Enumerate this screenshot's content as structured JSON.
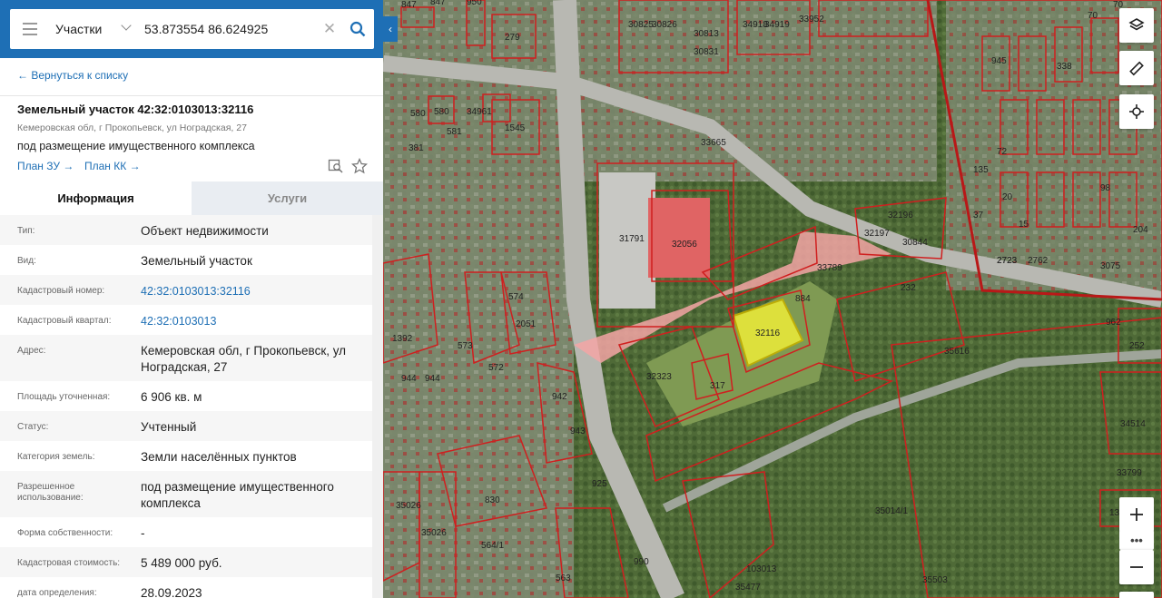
{
  "search": {
    "type_label": "Участки",
    "coords_value": "53.873554 86.624925"
  },
  "nav": {
    "back_label": "← Вернуться к списку"
  },
  "object": {
    "title": "Земельный участок 42:32:0103013:32116",
    "address_short": "Кемеровская обл, г Прокопьевск, ул Ноградская, 27",
    "purpose": "под размещение имущественного комплекса",
    "plan_zu": "План ЗУ →",
    "plan_kk": "План КК →"
  },
  "tabs": {
    "info": "Информация",
    "services": "Услуги"
  },
  "info_rows": [
    {
      "label": "Тип:",
      "value": "Объект недвижимости"
    },
    {
      "label": "Вид:",
      "value": "Земельный участок"
    },
    {
      "label": "Кадастровый номер:",
      "value": "42:32:0103013:32116"
    },
    {
      "label": "Кадастровый квартал:",
      "value": "42:32:0103013"
    },
    {
      "label": "Адрес:",
      "value": "Кемеровская обл, г Прокопьевск, ул Ноградская, 27"
    },
    {
      "label": "Площадь уточненная:",
      "value": "6 906 кв. м"
    },
    {
      "label": "Статус:",
      "value": "Учтенный"
    },
    {
      "label": "Категория земель:",
      "value": "Земли населённых пунктов"
    },
    {
      "label": "Разрешенное использование:",
      "value": "под размещение имущественного комплекса"
    },
    {
      "label": "Форма собственности:",
      "value": "-"
    },
    {
      "label": "Кадастровая стоимость:",
      "value": "5 489 000 руб."
    },
    {
      "label": "дата определения:",
      "value": "28.09.2023"
    }
  ],
  "map": {
    "parcel_labels": [
      "847",
      "847",
      "950",
      "279",
      "580",
      "580",
      "581",
      "381",
      "34961",
      "1545",
      "33665",
      "31791",
      "32056",
      "33789",
      "32116",
      "884",
      "32323",
      "317",
      "35616",
      "962",
      "252",
      "34514",
      "33799",
      "1322",
      "35014/1",
      "103013",
      "35503",
      "35477",
      "32196",
      "32197",
      "30844",
      "2723",
      "2762",
      "232",
      "574",
      "2051",
      "573",
      "572",
      "1392",
      "944",
      "944",
      "942",
      "943",
      "925",
      "830",
      "564/1",
      "35026",
      "35026",
      "990",
      "563",
      "30825",
      "30826",
      "30813",
      "30831",
      "34918",
      "34919",
      "33952",
      "70",
      "70",
      "945",
      "338",
      "2723",
      "3075",
      "204",
      "135",
      "20",
      "37",
      "15",
      "72",
      "98"
    ],
    "highlight_color": "#e8e83a",
    "boundary_color": "#d01f1f"
  },
  "controls": {
    "more_label": "•••"
  }
}
